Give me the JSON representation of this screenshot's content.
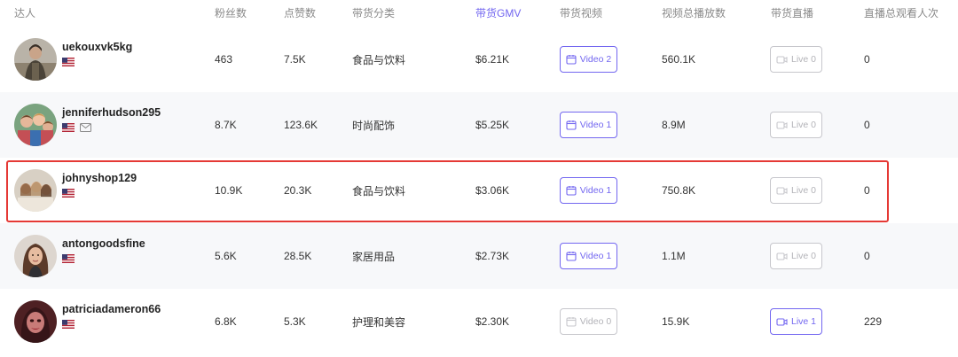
{
  "columns": {
    "influencer": "达人",
    "followers": "粉丝数",
    "likes": "点赞数",
    "category": "带货分类",
    "gmv": "带货GMV",
    "videos": "带货视频",
    "views": "视频总播放数",
    "live": "带货直播",
    "live_viewers": "直播总观看人次"
  },
  "sorted_column": "gmv",
  "colors": {
    "accent": "#7367f0",
    "highlight": "#e53935",
    "disabled": "#c7c7cc"
  },
  "rows": [
    {
      "username": "uekouxvk5kg",
      "country_flag": "US",
      "has_mail": false,
      "followers": "463",
      "likes": "7.5K",
      "category": "食品与饮料",
      "gmv": "$6.21K",
      "video_label": "Video 2",
      "video_count": 2,
      "views": "560.1K",
      "live_label": "Live 0",
      "live_count": 0,
      "live_viewers": "0"
    },
    {
      "username": "jenniferhudson295",
      "country_flag": "US",
      "has_mail": true,
      "followers": "8.7K",
      "likes": "123.6K",
      "category": "时尚配饰",
      "gmv": "$5.25K",
      "video_label": "Video 1",
      "video_count": 1,
      "views": "8.9M",
      "live_label": "Live 0",
      "live_count": 0,
      "live_viewers": "0"
    },
    {
      "username": "johnyshop129",
      "country_flag": "US",
      "has_mail": false,
      "followers": "10.9K",
      "likes": "20.3K",
      "category": "食品与饮料",
      "gmv": "$3.06K",
      "video_label": "Video 1",
      "video_count": 1,
      "views": "750.8K",
      "live_label": "Live 0",
      "live_count": 0,
      "live_viewers": "0",
      "highlighted": true
    },
    {
      "username": "antongoodsfine",
      "country_flag": "US",
      "has_mail": false,
      "followers": "5.6K",
      "likes": "28.5K",
      "category": "家居用品",
      "gmv": "$2.73K",
      "video_label": "Video 1",
      "video_count": 1,
      "views": "1.1M",
      "live_label": "Live 0",
      "live_count": 0,
      "live_viewers": "0"
    },
    {
      "username": "patriciadameron66",
      "country_flag": "US",
      "has_mail": false,
      "followers": "6.8K",
      "likes": "5.3K",
      "category": "护理和美容",
      "gmv": "$2.30K",
      "video_label": "Video 0",
      "video_count": 0,
      "views": "15.9K",
      "live_label": "Live 1",
      "live_count": 1,
      "live_viewers": "229"
    }
  ]
}
